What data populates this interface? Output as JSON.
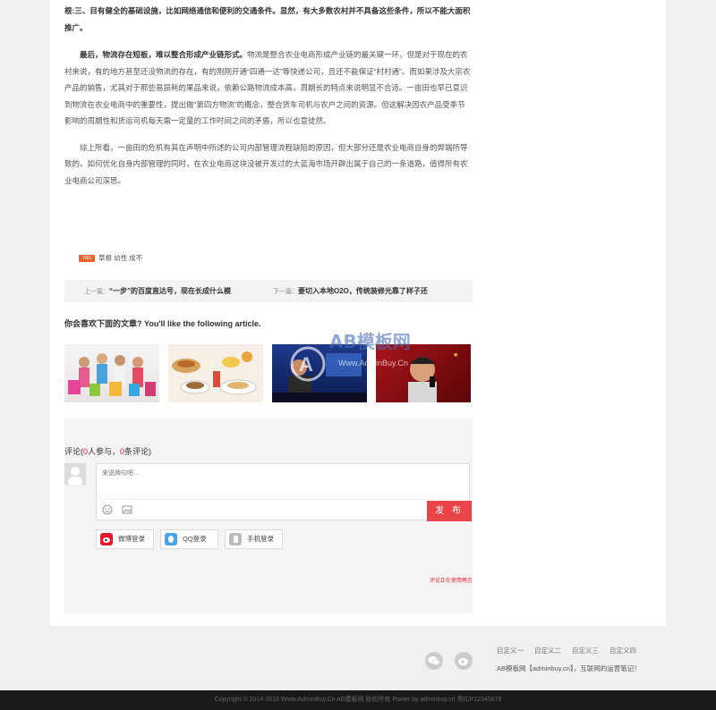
{
  "article": {
    "p0": "根:三、目有健全的基础设施，比如网络通信和便利的交通条件。显然，有大多数农村并不具备这些条件，所以不能大面积推广。",
    "p1_bold": "最后，物流存在短板，难以整合形成产业链形式。",
    "p1_rest": "物流是整合农业电商形成产业链的最关键一环，但是对于现在的农村来说，有的地方甚至还没物流的存在，有的刚刚开通“四通一达”等快递公司，且还不能保证“村村通”。而如果涉及大宗农产品的销售，尤其对于那些易损耗的果品来说，依赖公路物流成本高，周期长的特点来说明显不合适。一亩田也早已意识到物流在农业电商中的重要性，提出做“第四方物流”的概念，整合货车司机与农户之间的资源。但这解决因农产品受季节影响的周期性和货运司机每天需一定量的工作时间之间的矛盾，所以也意徒然。",
    "p2": "综上所看，一亩田的危机有其在声明中所述的公司内部管理流程缺陷的原因，但大部分还是农业电商自身的弊端所导致的。如何优化自身内部管理的同时，在农业电商这块没被开发过的大蓝海市场开辟出属于自己的一条道路，值得所有农业电商公司深思。"
  },
  "tags": {
    "icon_label": "TAG",
    "items": "草根 幼性 成不"
  },
  "prevnext": {
    "prev_label": "上一篇：",
    "prev_title": "“一步”的百度直达号，现在长成什么模",
    "next_label": "下一篇：",
    "next_title": "要切入本地O2O，传统装修光靠了样子还"
  },
  "related": {
    "title": "你会喜欢下面的文章? You'll like the following article."
  },
  "watermark": "AB模板网",
  "watermark_url": "Www.AdminBuy.Cn",
  "comments": {
    "title_prefix": "评论(",
    "participants": "0",
    "mid": "人参与，",
    "count": "0",
    "title_suffix": "条评论)",
    "placeholder": "来说两句吧...",
    "submit": "发 布",
    "weibo": "微博登录",
    "qq": "QQ登录",
    "phone": "手机登录",
    "notice": "评论正在使用畅言"
  },
  "footer": {
    "links": [
      "自定义一",
      "自定义二",
      "自定义三",
      "自定义四"
    ],
    "line": "AB模板网【adminbuy.cn】，互联网的运营笔记！",
    "copyright": "Copyright © 2014-2016 Www.AdminBuy.Cn AB模板网 版权所有 Power by adminbuy.cn 粤ICP12345678"
  },
  "colors": {
    "accent": "#e9444a",
    "tag": "#e8642c",
    "copyright_bg": "#1a1a1a"
  }
}
